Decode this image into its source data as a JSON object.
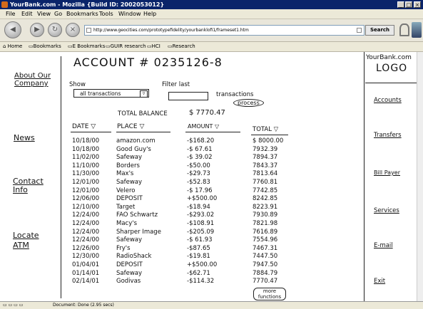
{
  "window": {
    "title": "YourBank.com - Mozilla {Build ID: 2002053012}",
    "controls": [
      "_",
      "□",
      "×"
    ]
  },
  "menu": [
    "File",
    "Edit",
    "View",
    "Go",
    "Bookmarks",
    "Tools",
    "Window",
    "Help"
  ],
  "nav": {
    "url": "http://www.geocities.com/prototypefidelity/yourbanklofi1/frameset1.htm",
    "search_label": "Search"
  },
  "bookmarks": [
    "Home",
    "Bookmarks",
    "E Bookmarks",
    "GUIR research",
    "HCI",
    "Research"
  ],
  "left_nav": [
    "About Our Company",
    "News",
    "Contact Info",
    "Locate ATM"
  ],
  "right_nav": {
    "logo_line1": "YourBank.com",
    "logo_line2": "LOGO",
    "items": [
      "Accounts",
      "Transfers",
      "Bill Payer",
      "Services",
      "E-mail",
      "Exit"
    ]
  },
  "account": {
    "title": "ACCOUNT # 0235126-8",
    "show_label": "Show",
    "show_value": "all transactions",
    "filter_label": "Filter last",
    "filter_suffix": "transactions",
    "process_label": "process",
    "total_balance_label": "TOTAL BALANCE",
    "total_balance_value": "$ 7770.47"
  },
  "table": {
    "headers": [
      "DATE ▽",
      "PLACE ▽",
      "AMOUNT ▽",
      "TOTAL ▽"
    ],
    "rows": [
      [
        "10/18/00",
        "amazon.com",
        "-$168.20",
        "$ 8000.00"
      ],
      [
        "10/18/00",
        "Good Guy's",
        "-$ 67.61",
        "7932.39"
      ],
      [
        "11/02/00",
        "Safeway",
        "-$ 39.02",
        "7894.37"
      ],
      [
        "11/10/00",
        "Borders",
        "-$50.00",
        "7843.37"
      ],
      [
        "11/30/00",
        "Max's",
        "-$29.73",
        "7813.64"
      ],
      [
        "12/01/00",
        "Safeway",
        "-$52.83",
        "7760.81"
      ],
      [
        "12/01/00",
        "Velero",
        "-$ 17.96",
        "7742.85"
      ],
      [
        "12/06/00",
        "DEPOSIT",
        "+$500.00",
        "8242.85"
      ],
      [
        "12/10/00",
        "Target",
        "-$18.94",
        "8223.91"
      ],
      [
        "12/24/00",
        "FAO Schwartz",
        "-$293.02",
        "7930.89"
      ],
      [
        "12/24/00",
        "Macy's",
        "-$108.91",
        "7821.98"
      ],
      [
        "12/24/00",
        "Sharper Image",
        "-$205.09",
        "7616.89"
      ],
      [
        "12/24/00",
        "Safeway",
        "-$ 61.93",
        "7554.96"
      ],
      [
        "12/26/00",
        "Fry's",
        "-$87.65",
        "7467.31"
      ],
      [
        "12/30/00",
        "RadioShack",
        "-$19.81",
        "7447.50"
      ],
      [
        "01/04/01",
        "DEPOSIT",
        "+$500.00",
        "7947.50"
      ],
      [
        "01/14/01",
        "Safeway",
        "-$62.71",
        "7884.79"
      ],
      [
        "02/14/01",
        "Godivas",
        "-$114.32",
        "7770.47"
      ]
    ],
    "more_label": "more functions"
  },
  "status": "Document: Done (2.95 secs)"
}
